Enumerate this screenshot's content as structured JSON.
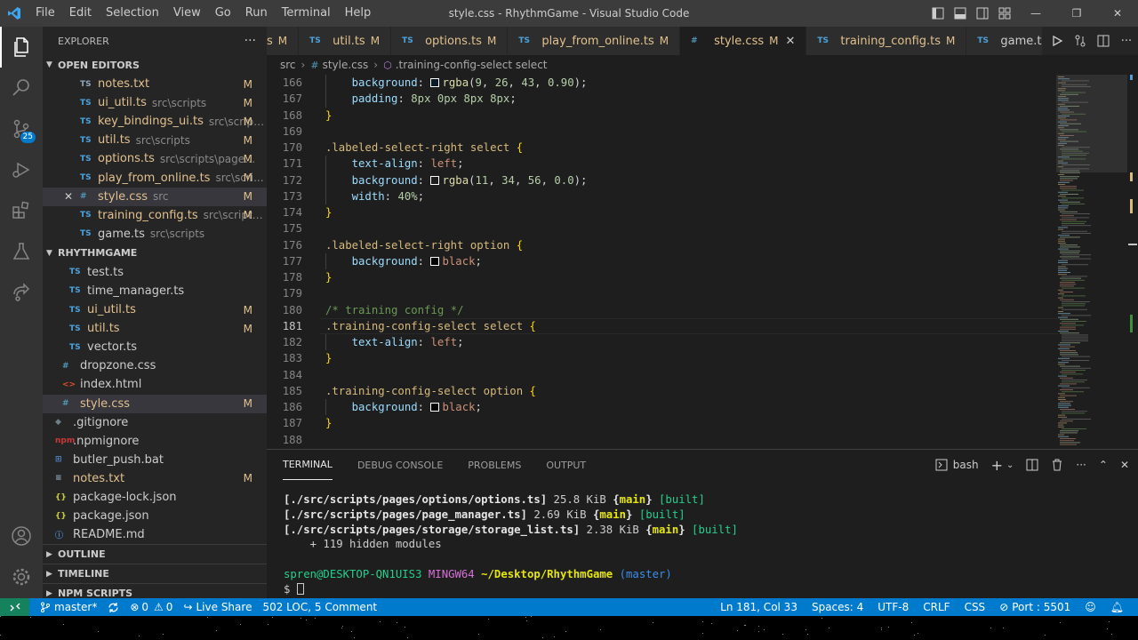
{
  "window": {
    "title": "style.css - RhythmGame - Visual Studio Code",
    "menu": [
      "File",
      "Edit",
      "Selection",
      "View",
      "Go",
      "Run",
      "Terminal",
      "Help"
    ]
  },
  "activity": {
    "source_control_badge": "25"
  },
  "sidebar": {
    "title": "EXPLORER",
    "more": "···",
    "open_editors_title": "OPEN EDITORS",
    "open_editors": [
      {
        "icon": "TS",
        "name": "notes.txt",
        "path": "",
        "status": "M",
        "kind": "txt"
      },
      {
        "icon": "TS",
        "name": "ui_util.ts",
        "path": "src\\scripts",
        "status": "M",
        "kind": "ts"
      },
      {
        "icon": "TS",
        "name": "key_bindings_ui.ts",
        "path": "src\\script...",
        "status": "M",
        "kind": "ts"
      },
      {
        "icon": "TS",
        "name": "util.ts",
        "path": "src\\scripts",
        "status": "M",
        "kind": "ts"
      },
      {
        "icon": "TS",
        "name": "options.ts",
        "path": "src\\scripts\\pages\\...",
        "status": "M",
        "kind": "ts"
      },
      {
        "icon": "TS",
        "name": "play_from_online.ts",
        "path": "src\\scri...",
        "status": "M",
        "kind": "ts"
      },
      {
        "icon": "#",
        "name": "style.css",
        "path": "src",
        "status": "M",
        "kind": "css"
      },
      {
        "icon": "TS",
        "name": "training_config.ts",
        "path": "src\\scripts...",
        "status": "M",
        "kind": "ts"
      },
      {
        "icon": "TS",
        "name": "game.ts",
        "path": "src\\scripts",
        "status": "",
        "kind": "ts"
      }
    ],
    "close_glyph": "✕",
    "project_title": "RHYTHMGAME",
    "files": [
      {
        "icon": "TS",
        "name": "test.ts",
        "status": "",
        "kind": "ts",
        "indent": 1
      },
      {
        "icon": "TS",
        "name": "time_manager.ts",
        "status": "",
        "kind": "ts",
        "indent": 1
      },
      {
        "icon": "TS",
        "name": "ui_util.ts",
        "status": "M",
        "kind": "ts",
        "indent": 1
      },
      {
        "icon": "TS",
        "name": "util.ts",
        "status": "M",
        "kind": "ts",
        "indent": 1
      },
      {
        "icon": "TS",
        "name": "vector.ts",
        "status": "",
        "kind": "ts",
        "indent": 1
      },
      {
        "icon": "#",
        "name": "dropzone.css",
        "status": "",
        "kind": "css",
        "indent": 0
      },
      {
        "icon": "<>",
        "name": "index.html",
        "status": "",
        "kind": "html",
        "indent": 0
      },
      {
        "icon": "#",
        "name": "style.css",
        "status": "M",
        "kind": "css",
        "indent": 0
      },
      {
        "icon": "◆",
        "name": ".gitignore",
        "status": "",
        "kind": "git",
        "indent": -1
      },
      {
        "icon": "npm",
        "name": ".npmignore",
        "status": "",
        "kind": "npm",
        "indent": -1
      },
      {
        "icon": "⊞",
        "name": "butler_push.bat",
        "status": "",
        "kind": "bat",
        "indent": -1
      },
      {
        "icon": "≡",
        "name": "notes.txt",
        "status": "M",
        "kind": "txt",
        "indent": -1
      },
      {
        "icon": "{}",
        "name": "package-lock.json",
        "status": "",
        "kind": "json",
        "indent": -1
      },
      {
        "icon": "{}",
        "name": "package.json",
        "status": "",
        "kind": "json",
        "indent": -1
      },
      {
        "icon": "ⓘ",
        "name": "README.md",
        "status": "",
        "kind": "bat",
        "indent": -1
      }
    ],
    "outline_title": "OUTLINE",
    "timeline_title": "TIMELINE",
    "npm_title": "NPM SCRIPTS"
  },
  "tabs": [
    {
      "icon": "",
      "label": "s",
      "status": "M",
      "active": false
    },
    {
      "icon": "TS",
      "label": "util.ts",
      "status": "M",
      "active": false
    },
    {
      "icon": "TS",
      "label": "options.ts",
      "status": "M",
      "active": false
    },
    {
      "icon": "TS",
      "label": "play_from_online.ts",
      "status": "M",
      "active": false
    },
    {
      "icon": "#",
      "label": "style.css",
      "status": "M",
      "active": true
    },
    {
      "icon": "TS",
      "label": "training_config.ts",
      "status": "M",
      "active": false
    },
    {
      "icon": "TS",
      "label": "game.ts",
      "status": "",
      "active": false
    }
  ],
  "breadcrumb": {
    "folder": "src",
    "file": "style.css",
    "symbol": ".training-config-select select"
  },
  "editor": {
    "current_line": 181,
    "lines": [
      {
        "n": "166",
        "indent": 1,
        "parts": [
          [
            "pr",
            "background"
          ],
          [
            "pn",
            ": "
          ],
          [
            "sw",
            "rgba(9, 26, 43, 0.90)"
          ],
          [
            "fn",
            "rgba"
          ],
          [
            "pn",
            "("
          ],
          [
            "nm",
            "9"
          ],
          [
            "pn",
            ", "
          ],
          [
            "nm",
            "26"
          ],
          [
            "pn",
            ", "
          ],
          [
            "nm",
            "43"
          ],
          [
            "pn",
            ", "
          ],
          [
            "nm",
            "0.90"
          ],
          [
            "pn",
            ");"
          ]
        ]
      },
      {
        "n": "167",
        "indent": 1,
        "parts": [
          [
            "pr",
            "padding"
          ],
          [
            "pn",
            ": "
          ],
          [
            "nm",
            "8px 0px 8px 8px"
          ],
          [
            "pn",
            ";"
          ]
        ]
      },
      {
        "n": "168",
        "indent": 0,
        "parts": [
          [
            "br",
            "}"
          ]
        ]
      },
      {
        "n": "169",
        "indent": 0,
        "parts": []
      },
      {
        "n": "170",
        "indent": 0,
        "parts": [
          [
            "sel-c",
            ".labeled-select-right select "
          ],
          [
            "br",
            "{"
          ]
        ]
      },
      {
        "n": "171",
        "indent": 1,
        "parts": [
          [
            "pr",
            "text-align"
          ],
          [
            "pn",
            ": "
          ],
          [
            "vl",
            "left"
          ],
          [
            "pn",
            ";"
          ]
        ]
      },
      {
        "n": "172",
        "indent": 1,
        "parts": [
          [
            "pr",
            "background"
          ],
          [
            "pn",
            ": "
          ],
          [
            "sw",
            "rgba(11, 34, 56, 0.0)"
          ],
          [
            "fn",
            "rgba"
          ],
          [
            "pn",
            "("
          ],
          [
            "nm",
            "11"
          ],
          [
            "pn",
            ", "
          ],
          [
            "nm",
            "34"
          ],
          [
            "pn",
            ", "
          ],
          [
            "nm",
            "56"
          ],
          [
            "pn",
            ", "
          ],
          [
            "nm",
            "0.0"
          ],
          [
            "pn",
            ");"
          ]
        ]
      },
      {
        "n": "173",
        "indent": 1,
        "parts": [
          [
            "pr",
            "width"
          ],
          [
            "pn",
            ": "
          ],
          [
            "nm",
            "40%"
          ],
          [
            "pn",
            ";"
          ]
        ]
      },
      {
        "n": "174",
        "indent": 0,
        "parts": [
          [
            "br",
            "}"
          ]
        ]
      },
      {
        "n": "175",
        "indent": 0,
        "parts": []
      },
      {
        "n": "176",
        "indent": 0,
        "parts": [
          [
            "sel-c",
            ".labeled-select-right option "
          ],
          [
            "br",
            "{"
          ]
        ]
      },
      {
        "n": "177",
        "indent": 1,
        "parts": [
          [
            "pr",
            "background"
          ],
          [
            "pn",
            ": "
          ],
          [
            "sw",
            "black"
          ],
          [
            "vl",
            "black"
          ],
          [
            "pn",
            ";"
          ]
        ]
      },
      {
        "n": "178",
        "indent": 0,
        "parts": [
          [
            "br",
            "}"
          ]
        ]
      },
      {
        "n": "179",
        "indent": 0,
        "parts": []
      },
      {
        "n": "180",
        "indent": 0,
        "parts": [
          [
            "cm",
            "/* training config */"
          ]
        ]
      },
      {
        "n": "181",
        "indent": 0,
        "parts": [
          [
            "sel-c",
            ".training-config-select select "
          ],
          [
            "br",
            "{"
          ]
        ]
      },
      {
        "n": "182",
        "indent": 1,
        "parts": [
          [
            "pr",
            "text-align"
          ],
          [
            "pn",
            ": "
          ],
          [
            "vl",
            "left"
          ],
          [
            "pn",
            ";"
          ]
        ]
      },
      {
        "n": "183",
        "indent": 0,
        "parts": [
          [
            "br",
            "}"
          ]
        ]
      },
      {
        "n": "184",
        "indent": 0,
        "parts": []
      },
      {
        "n": "185",
        "indent": 0,
        "parts": [
          [
            "sel-c",
            ".training-config-select option "
          ],
          [
            "br",
            "{"
          ]
        ]
      },
      {
        "n": "186",
        "indent": 1,
        "parts": [
          [
            "pr",
            "background"
          ],
          [
            "pn",
            ": "
          ],
          [
            "sw",
            "black"
          ],
          [
            "vl",
            "black"
          ],
          [
            "pn",
            ";"
          ]
        ]
      },
      {
        "n": "187",
        "indent": 0,
        "parts": [
          [
            "br",
            "}"
          ]
        ]
      },
      {
        "n": "188",
        "indent": 0,
        "parts": []
      }
    ]
  },
  "panel": {
    "tabs": [
      "TERMINAL",
      "DEBUG CONSOLE",
      "PROBLEMS",
      "OUTPUT"
    ],
    "active_tab": "TERMINAL",
    "shell": "bash",
    "terminal": [
      {
        "path": "[./src/scripts/pages/options/options.ts]",
        "size": " 25.8 KiB ",
        "chunk": "main",
        "built": "[built]"
      },
      {
        "path": "[./src/scripts/pages/page_manager.ts]",
        "size": " 2.69 KiB ",
        "chunk": "main",
        "built": "[built]"
      },
      {
        "path": "[./src/scripts/pages/storage/storage_list.ts]",
        "size": " 2.38 KiB ",
        "chunk": "main",
        "built": "[built]"
      }
    ],
    "hidden_modules": "    + 119 hidden modules",
    "prompt_user": "spren@DESKTOP-QN1UIS3",
    "prompt_sys": "MINGW64",
    "prompt_path": "~/Desktop/RhythmGame",
    "prompt_branch": "(master)",
    "prompt_symbol": "$"
  },
  "statusbar": {
    "branch": "master*",
    "errors": "0",
    "warnings": "0",
    "live_share": "Live Share",
    "loc": "502 LOC, 5 Comment",
    "position": "Ln 181, Col 33",
    "spaces": "Spaces: 4",
    "encoding": "UTF-8",
    "eol": "CRLF",
    "language": "CSS",
    "port": "Port : 5501"
  }
}
